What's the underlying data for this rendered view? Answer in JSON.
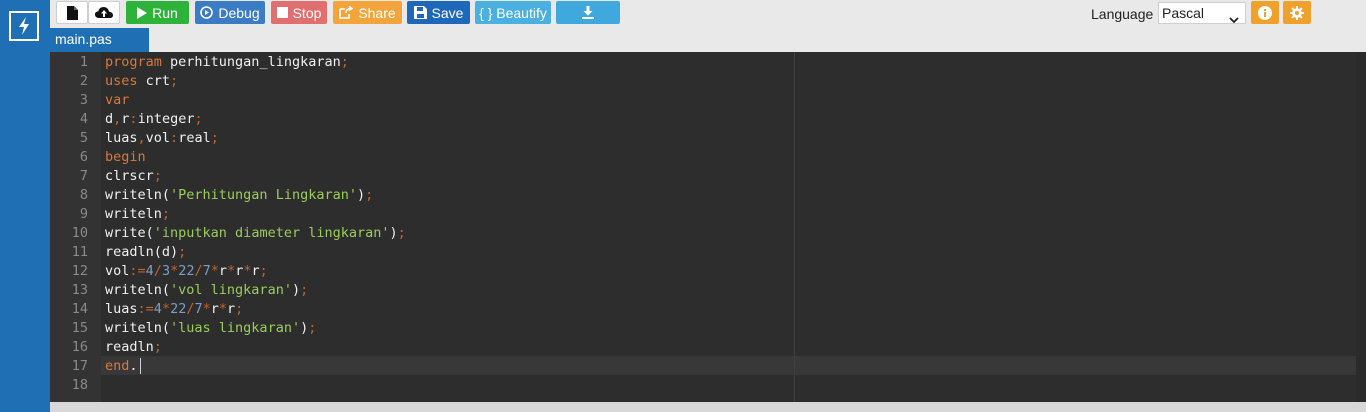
{
  "app": {
    "accent": "#1f6fb5",
    "logo_icon": "bolt-icon"
  },
  "toolbar": {
    "new_icon": "file-icon",
    "upload_icon": "cloud-upload-icon",
    "run_label": "Run",
    "debug_label": "Debug",
    "stop_label": "Stop",
    "share_label": "Share",
    "save_label": "Save",
    "beautify_label": "{ } Beautify",
    "download_icon": "download-icon",
    "language_label": "Language",
    "language_value": "Pascal",
    "info_icon": "info-icon",
    "settings_icon": "gear-icon",
    "colors": {
      "run": "#2eb33a",
      "debug": "#3c7cc4",
      "stop": "#e26f6f",
      "share": "#f3a43b",
      "save": "#1d68b8",
      "beautify": "#4ab0e0",
      "orange_icons": "#f0a12b"
    }
  },
  "tabs": [
    {
      "label": "main.pas",
      "active": true
    }
  ],
  "editor": {
    "line_numbers": [
      "1",
      "2",
      "3",
      "4",
      "5",
      "6",
      "7",
      "8",
      "9",
      "10",
      "11",
      "12",
      "13",
      "14",
      "15",
      "16",
      "17",
      "18"
    ],
    "lines": [
      "program perhitungan_lingkaran;",
      "uses crt;",
      "var",
      "d,r:integer;",
      "luas,vol:real;",
      "begin",
      "clrscr;",
      "writeln('Perhitungan Lingkaran');",
      "writeln;",
      "write('inputkan diameter lingkaran');",
      "readln(d);",
      "vol:=4/3*22/7*r*r*r;",
      "writeln('vol lingkaran');",
      "luas:=4*22/7*r*r;",
      "writeln('luas lingkaran');",
      "readln;",
      "end.",
      ""
    ],
    "active_line": 17
  }
}
